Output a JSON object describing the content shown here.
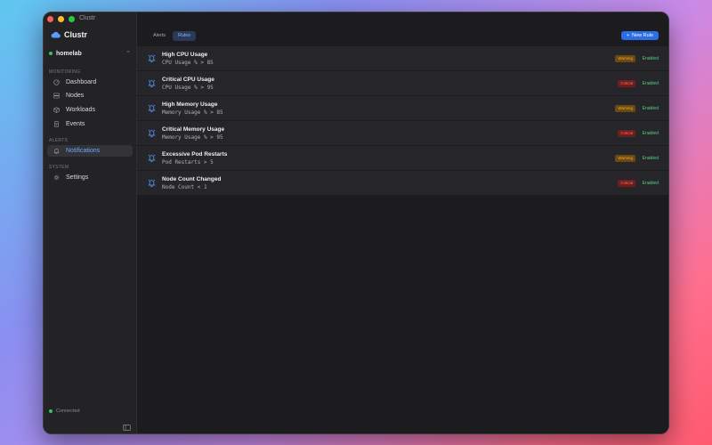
{
  "window": {
    "title": "Clustr"
  },
  "sidebar": {
    "brand": "Clustr",
    "cluster": {
      "name": "homelab"
    },
    "sections": [
      {
        "label": "MONITORING",
        "items": [
          {
            "label": "Dashboard",
            "icon": "gauge-icon"
          },
          {
            "label": "Nodes",
            "icon": "server-icon"
          },
          {
            "label": "Workloads",
            "icon": "cube-icon"
          },
          {
            "label": "Events",
            "icon": "document-icon"
          }
        ]
      },
      {
        "label": "ALERTS",
        "items": [
          {
            "label": "Notifications",
            "icon": "bell-icon",
            "active": true
          }
        ]
      },
      {
        "label": "SYSTEM",
        "items": [
          {
            "label": "Settings",
            "icon": "gear-icon"
          }
        ]
      }
    ],
    "status": "Connected"
  },
  "toolbar": {
    "tabs": [
      {
        "label": "Alerts"
      },
      {
        "label": "Rules",
        "active": true
      }
    ],
    "new_rule_label": "New Rule"
  },
  "rules": [
    {
      "title": "High CPU Usage",
      "condition": "CPU Usage % > 85",
      "severity": "Warning",
      "state": "Enabled"
    },
    {
      "title": "Critical CPU Usage",
      "condition": "CPU Usage % > 95",
      "severity": "Critical",
      "state": "Enabled"
    },
    {
      "title": "High Memory Usage",
      "condition": "Memory Usage % > 85",
      "severity": "Warning",
      "state": "Enabled"
    },
    {
      "title": "Critical Memory Usage",
      "condition": "Memory Usage % > 95",
      "severity": "Critical",
      "state": "Enabled"
    },
    {
      "title": "Excessive Pod Restarts",
      "condition": "Pod Restarts > 5",
      "severity": "Warning",
      "state": "Enabled"
    },
    {
      "title": "Node Count Changed",
      "condition": "Node Count < 1",
      "severity": "Critical",
      "state": "Enabled"
    }
  ],
  "colors": {
    "accent": "#2b6ee8",
    "warning": "#f0a83a",
    "critical": "#ff6b6b",
    "enabled": "#5ad07a"
  }
}
